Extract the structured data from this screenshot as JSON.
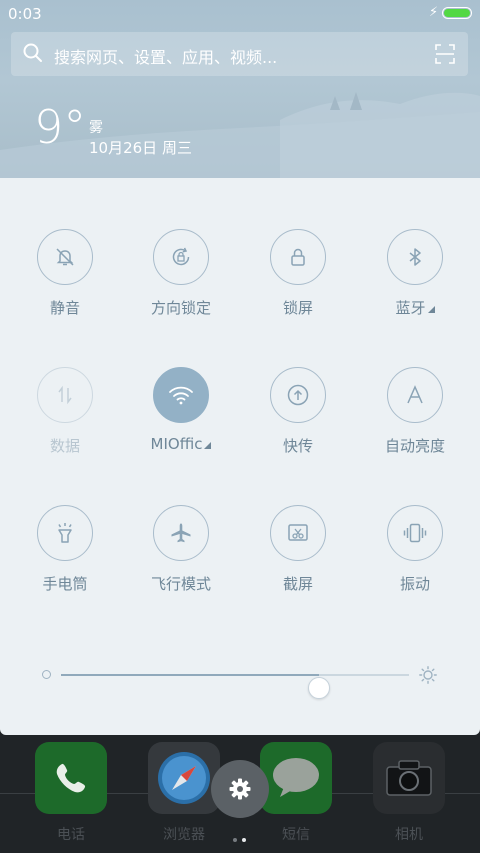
{
  "status_bar": {
    "time": "0:03",
    "charging_icon": "bolt-icon",
    "battery_color": "#53d844"
  },
  "search": {
    "placeholder": "搜索网页、设置、应用、视频..."
  },
  "weather": {
    "temperature": "9°",
    "condition": "雾",
    "date": "10月26日 周三"
  },
  "tiles": [
    {
      "label": "静音",
      "icon": "bell-off-icon",
      "state": "off",
      "has_menu": false
    },
    {
      "label": "方向锁定",
      "icon": "rotation-lock-icon",
      "state": "off",
      "has_menu": false
    },
    {
      "label": "锁屏",
      "icon": "lock-icon",
      "state": "off",
      "has_menu": false
    },
    {
      "label": "蓝牙",
      "icon": "bluetooth-icon",
      "state": "off",
      "has_menu": true
    },
    {
      "label": "数据",
      "icon": "mobile-data-icon",
      "state": "disabled",
      "has_menu": false
    },
    {
      "label": "MIOffic",
      "icon": "wifi-icon",
      "state": "on",
      "has_menu": true
    },
    {
      "label": "快传",
      "icon": "quick-transfer-icon",
      "state": "off",
      "has_menu": false
    },
    {
      "label": "自动亮度",
      "icon": "auto-brightness-icon",
      "state": "off",
      "has_menu": false
    },
    {
      "label": "手电筒",
      "icon": "flashlight-icon",
      "state": "off",
      "has_menu": false
    },
    {
      "label": "飞行模式",
      "icon": "airplane-icon",
      "state": "off",
      "has_menu": false
    },
    {
      "label": "截屏",
      "icon": "screenshot-icon",
      "state": "off",
      "has_menu": false
    },
    {
      "label": "振动",
      "icon": "vibrate-icon",
      "state": "off",
      "has_menu": false
    }
  ],
  "brightness": {
    "level": 0.74
  },
  "dock": [
    {
      "label": "电话",
      "icon": "phone-icon",
      "color": "#1f8a32"
    },
    {
      "label": "浏览器",
      "icon": "browser-icon",
      "color": "#3a3f44"
    },
    {
      "label": "短信",
      "icon": "messages-icon",
      "color": "#1f8a32"
    },
    {
      "label": "相机",
      "icon": "camera-icon",
      "color": "#2a2d30"
    }
  ],
  "colors": {
    "accent": "#93b1c6",
    "panel_bg": "#ecf1f4",
    "tile_label": "#6f8798"
  }
}
